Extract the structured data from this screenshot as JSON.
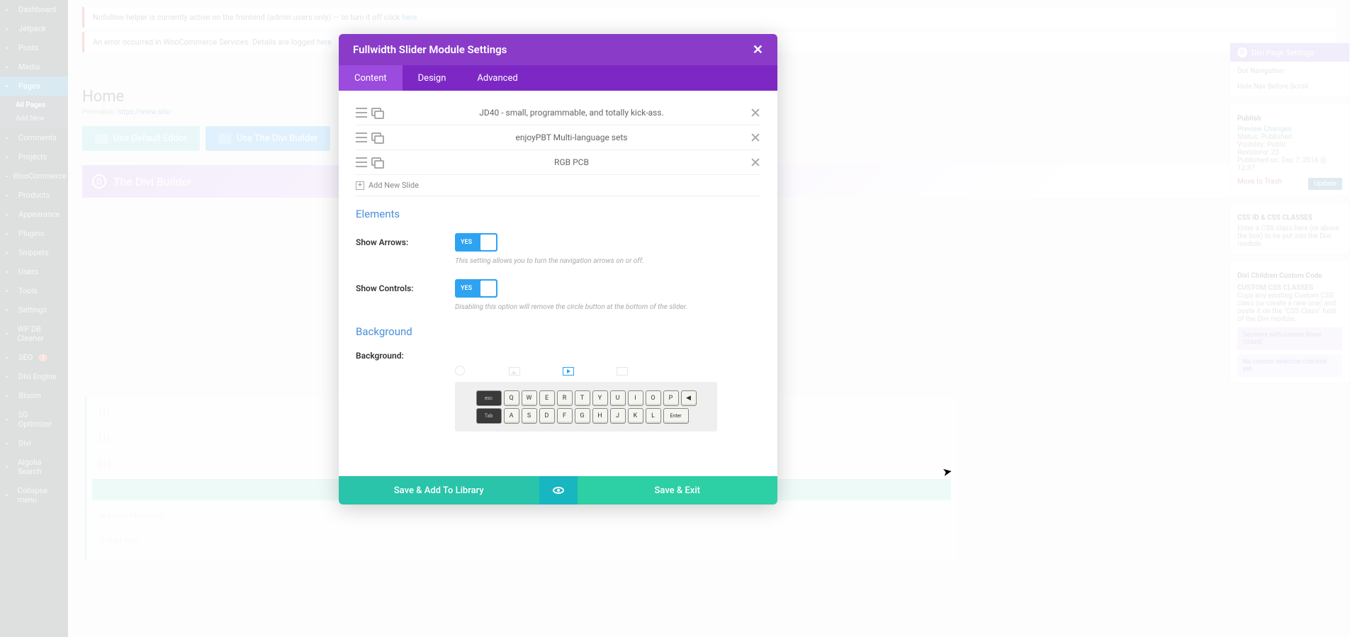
{
  "wp_sidebar": {
    "items": [
      {
        "label": "Dashboard",
        "icon": "gauge"
      },
      {
        "label": "Jetpack",
        "icon": "jet"
      },
      {
        "label": "Posts",
        "icon": "pin"
      },
      {
        "label": "Media",
        "icon": "media"
      },
      {
        "label": "Pages",
        "icon": "page",
        "active": true
      },
      {
        "label": "Comments",
        "icon": "comment"
      },
      {
        "label": "Projects",
        "icon": "wand"
      },
      {
        "label": "WooCommerce",
        "icon": "cart"
      },
      {
        "label": "Products",
        "icon": "box"
      },
      {
        "label": "Appearance",
        "icon": "brush"
      },
      {
        "label": "Plugins",
        "icon": "plug"
      },
      {
        "label": "Snippets",
        "icon": "scissors"
      },
      {
        "label": "Users",
        "icon": "user"
      },
      {
        "label": "Tools",
        "icon": "wrench"
      },
      {
        "label": "Settings",
        "icon": "gear"
      },
      {
        "label": "WP DB Cleaner",
        "icon": "db"
      },
      {
        "label": "SEO",
        "icon": "seo",
        "badge": "1"
      },
      {
        "label": "Divi Engine",
        "icon": "engine"
      },
      {
        "label": "Bloom",
        "icon": "flower"
      },
      {
        "label": "SG Optimizer",
        "icon": "opt"
      },
      {
        "label": "Divi",
        "icon": "divi"
      },
      {
        "label": "Algolia Search",
        "icon": "search"
      },
      {
        "label": "Collapse menu",
        "icon": "collapse"
      }
    ],
    "submenu": [
      {
        "label": "All Pages",
        "current": true
      },
      {
        "label": "Add New"
      }
    ]
  },
  "page_behind": {
    "notice1_prefix": "Nofollow helper is currently active on the frontend (admin users only) — to turn it off click ",
    "notice1_link": "here",
    "notice2_prefix": "An error occurred in WooCommerce Services. Details are logged ",
    "notice2_link": "here",
    "title": "Home",
    "permalink_label": "Permalink:",
    "permalink_url": "https://www.site/",
    "btn_default": "Use Default Editor",
    "btn_builder": "Use The Divi Builder",
    "divi_banner": "The Divi Builder"
  },
  "right_side": {
    "panel_title": "Divi Page Settings",
    "dot_nav": "Dot Navigation",
    "hide_nav": "Hide Nav Before Scroll",
    "publish_h": "Publish",
    "preview": "Preview Changes",
    "status": "Status: Published",
    "visibility": "Visibility: Public",
    "revisions": "Revisions: 23",
    "pub_on": "Published on: Dec 7, 2016 @ 12:37",
    "trash": "Move to Trash",
    "update": "Update",
    "classes_h": "CSS ID & CSS CLASSES",
    "classes_desc": "Enter a CSS class here (or above the box) to be put into the Divi module.",
    "custom_code_h": "Divi Children Custom Code",
    "custom_classes_h": "CUSTOM CSS CLASSES",
    "custom_desc": "Copy any existing Custom CSS class (or create a new one) and paste it on the \"CSS Class\" field of the Divi module.",
    "helper1": "Sections with custom Rows (class)",
    "helper2": "No custom selection checked yet"
  },
  "modal": {
    "title": "Fullwidth Slider Module Settings",
    "tabs": [
      "Content",
      "Design",
      "Advanced"
    ],
    "slides": [
      "JD40 - small, programmable, and totally kick-ass.",
      "enjoyPBT Multi-language sets",
      "RGB PCB"
    ],
    "add_slide": "Add New Slide",
    "section_elements": "Elements",
    "show_arrows_label": "Show Arrows:",
    "show_arrows_val": "YES",
    "show_arrows_desc": "This setting allows you to turn the navigation arrows on or off.",
    "show_controls_label": "Show Controls:",
    "show_controls_val": "YES",
    "show_controls_desc": "Disabling this option will remove the circle button at the bottom of the slider.",
    "section_background": "Background",
    "bg_label": "Background:",
    "footer_lib": "Save & Add To Library",
    "footer_exit": "Save & Exit"
  },
  "keyboard": {
    "row1": [
      "esc",
      "Q",
      "W",
      "E",
      "R",
      "T",
      "Y",
      "U",
      "I",
      "O",
      "P",
      "◀"
    ],
    "row2": [
      "Tab",
      "A",
      "S",
      "D",
      "F",
      "G",
      "H",
      "J",
      "K",
      "L",
      "Enter"
    ]
  }
}
